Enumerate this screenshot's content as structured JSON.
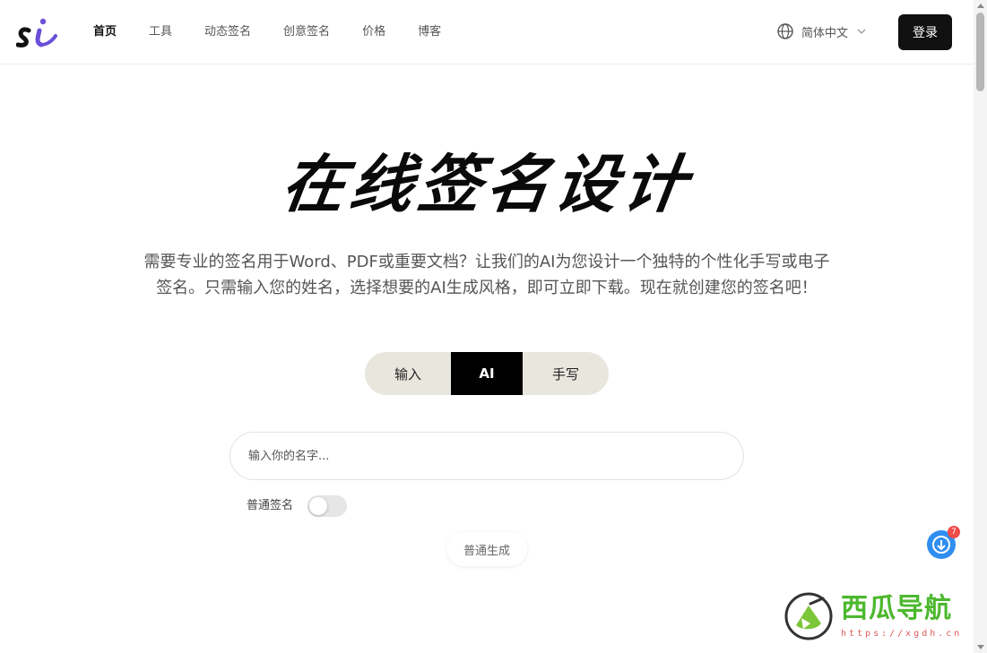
{
  "header": {
    "nav": [
      {
        "label": "首页",
        "active": true
      },
      {
        "label": "工具"
      },
      {
        "label": "动态签名"
      },
      {
        "label": "创意签名"
      },
      {
        "label": "价格"
      },
      {
        "label": "博客"
      }
    ],
    "language": "简体中文",
    "login_label": "登录",
    "logo_icon": "si-logo-icon"
  },
  "hero": {
    "title": "在线签名设计",
    "description": "需要专业的签名用于Word、PDF或重要文档？让我们的AI为您设计一个独特的个性化手写或电子签名。只需输入您的姓名，选择想要的AI生成风格，即可立即下载。现在就创建您的签名吧！"
  },
  "tabs": [
    {
      "label": "输入"
    },
    {
      "label": "AI",
      "selected": true
    },
    {
      "label": "手写"
    }
  ],
  "form": {
    "name_placeholder": "输入你的名字...",
    "name_value": "",
    "toggle_label": "普通签名",
    "toggle_on": false,
    "generate_label": "普通生成"
  },
  "float": {
    "badge_count": "7",
    "icon": "download-app-icon"
  },
  "watermark": {
    "title": "西瓜导航",
    "url": "https://xgdh.cn"
  },
  "colors": {
    "accent": "#000000",
    "tab_bg": "#e9e6de",
    "float_blue": "#2f8ef0",
    "badge_red": "#f04a4a",
    "watermark_green": "#4cb82e"
  }
}
